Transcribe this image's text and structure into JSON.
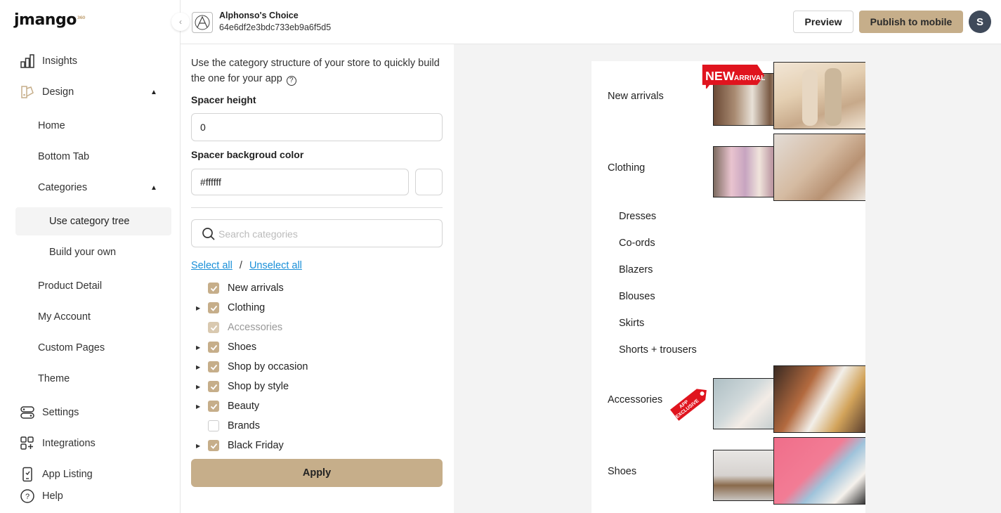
{
  "brand": {
    "logo_text": "jmango",
    "logo_sup": "360"
  },
  "sidebar": {
    "insights": "Insights",
    "design": "Design",
    "design_sub": {
      "home": "Home",
      "bottom_tab": "Bottom Tab",
      "categories": "Categories",
      "categories_sub": {
        "use_tree": "Use category tree",
        "build_own": "Build your own"
      },
      "product_detail": "Product Detail",
      "my_account": "My Account",
      "custom_pages": "Custom Pages",
      "theme": "Theme"
    },
    "settings": "Settings",
    "integrations": "Integrations",
    "app_listing": "App Listing",
    "help": "Help"
  },
  "header": {
    "store_name": "Alphonso's Choice",
    "store_id": "64e6df2e3bdc733eb9a6f5d5",
    "preview_label": "Preview",
    "publish_label": "Publish to mobile",
    "avatar_initial": "S"
  },
  "panel": {
    "intro": "Use the category structure of your store to quickly build the one for your app",
    "spacer_height_label": "Spacer height",
    "spacer_height_value": "0",
    "spacer_bg_label": "Spacer backgroud color",
    "spacer_bg_value": "#ffffff",
    "search_placeholder": "Search categories",
    "select_all": "Select all",
    "separator": "/",
    "unselect_all": "Unselect all",
    "categories": [
      {
        "label": "New arrivals",
        "checked": true,
        "expandable": false,
        "dim": false
      },
      {
        "label": "Clothing",
        "checked": true,
        "expandable": true,
        "dim": false
      },
      {
        "label": "Accessories",
        "checked": true,
        "expandable": false,
        "dim": true
      },
      {
        "label": "Shoes",
        "checked": true,
        "expandable": true,
        "dim": false
      },
      {
        "label": "Shop by occasion",
        "checked": true,
        "expandable": true,
        "dim": false
      },
      {
        "label": "Shop by style",
        "checked": true,
        "expandable": true,
        "dim": false
      },
      {
        "label": "Beauty",
        "checked": true,
        "expandable": true,
        "dim": false
      },
      {
        "label": "Brands",
        "checked": false,
        "expandable": false,
        "dim": false
      },
      {
        "label": "Black Friday",
        "checked": true,
        "expandable": true,
        "dim": false
      }
    ],
    "apply_label": "Apply"
  },
  "preview": {
    "categories": [
      "New arrivals",
      "Clothing",
      "Accessories",
      "Shoes"
    ],
    "clothing_sub": [
      "Dresses",
      "Co-ords",
      "Blazers",
      "Blouses",
      "Skirts",
      "Shorts + trousers"
    ],
    "new_tag_big": "NEW",
    "new_tag_small": "ARRIVAL",
    "excl_tag_line1": "APP",
    "excl_tag_line2": "EXCLUSIVE"
  },
  "colors": {
    "accent": "#c6ae8a",
    "link": "#1a8fd8",
    "avatar": "#3f4a5a",
    "tag_red": "#e0141e"
  }
}
